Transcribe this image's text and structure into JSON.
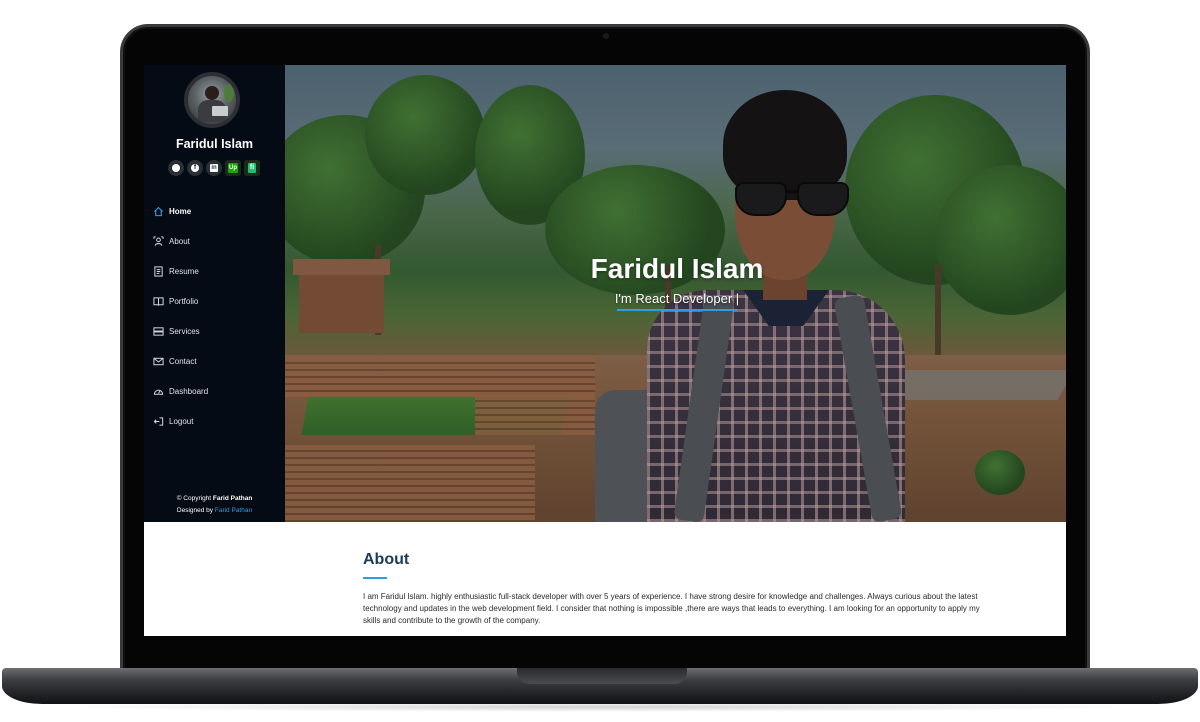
{
  "sidebar": {
    "name": "Faridul Islam",
    "socials": [
      {
        "icon": "github-icon"
      },
      {
        "icon": "facebook-icon"
      },
      {
        "icon": "linkedin-icon"
      },
      {
        "icon": "upwork-icon",
        "text": "Up"
      },
      {
        "icon": "fiverr-icon",
        "text": "fi"
      }
    ],
    "nav": [
      {
        "label": "Home",
        "icon": "home-icon",
        "active": true
      },
      {
        "label": "About",
        "icon": "user-icon"
      },
      {
        "label": "Resume",
        "icon": "document-icon"
      },
      {
        "label": "Portfolio",
        "icon": "book-icon"
      },
      {
        "label": "Services",
        "icon": "server-icon"
      },
      {
        "label": "Contact",
        "icon": "envelope-icon"
      },
      {
        "label": "Dashboard",
        "icon": "gauge-icon"
      },
      {
        "label": "Logout",
        "icon": "logout-icon"
      }
    ],
    "copyright_prefix": "© Copyright",
    "copyright_name": "Farid Pathan",
    "designed_prefix": "Designed by",
    "designed_name": "Farid Pathan"
  },
  "hero": {
    "name": "Faridul Islam",
    "subtitle": "I'm React Developer |"
  },
  "about": {
    "title": "About",
    "text": "I am Faridul Islam. highly enthusiastic full-stack developer with over 5 years of experience. I have strong desire for knowledge and challenges. Always curious about the latest technology and updates in the web development field. I consider that nothing is impossible ,there are ways that leads to everything. I am looking for an opportunity to apply my skills and contribute to the growth of the company."
  },
  "colors": {
    "sidebar_bg": "#040b14",
    "accent": "#2f9ee0",
    "heading": "#1b3a5c"
  }
}
